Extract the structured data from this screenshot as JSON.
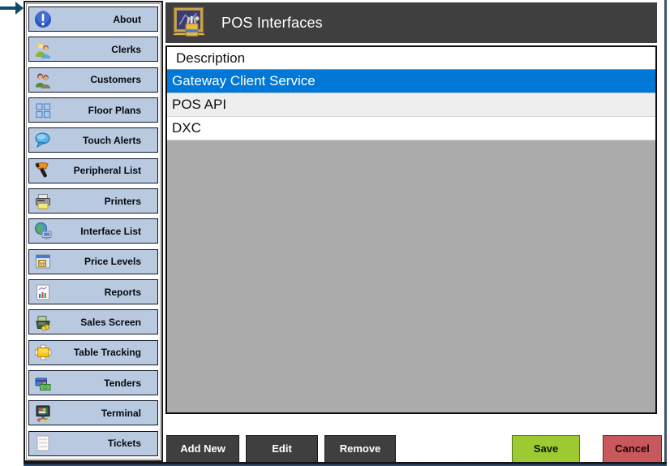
{
  "annotation": {
    "points_to": "Interface List",
    "arrow_color": "#0e4d68"
  },
  "sidebar": {
    "items": [
      {
        "label": "About",
        "icon": "about-icon"
      },
      {
        "label": "Clerks",
        "icon": "clerks-icon"
      },
      {
        "label": "Customers",
        "icon": "customers-icon"
      },
      {
        "label": "Floor Plans",
        "icon": "floor-plans-icon"
      },
      {
        "label": "Touch Alerts",
        "icon": "touch-alerts-icon"
      },
      {
        "label": "Peripheral List",
        "icon": "peripheral-list-icon"
      },
      {
        "label": "Printers",
        "icon": "printers-icon"
      },
      {
        "label": "Interface List",
        "icon": "interface-list-icon"
      },
      {
        "label": "Price Levels",
        "icon": "price-levels-icon"
      },
      {
        "label": "Reports",
        "icon": "reports-icon"
      },
      {
        "label": "Sales Screen",
        "icon": "sales-screen-icon"
      },
      {
        "label": "Table Tracking",
        "icon": "table-tracking-icon"
      },
      {
        "label": "Tenders",
        "icon": "tenders-icon"
      },
      {
        "label": "Terminal",
        "icon": "terminal-icon"
      },
      {
        "label": "Tickets",
        "icon": "tickets-icon"
      }
    ]
  },
  "header": {
    "title": "POS Interfaces",
    "icon": "pos-board-icon"
  },
  "list": {
    "column_header": "Description",
    "rows": [
      {
        "label": "Gateway Client Service",
        "selected": true
      },
      {
        "label": "POS API",
        "selected": false
      },
      {
        "label": "DXC",
        "selected": false
      }
    ]
  },
  "actions": {
    "add_new": "Add New",
    "edit": "Edit",
    "remove": "Remove",
    "save": "Save",
    "cancel": "Cancel"
  },
  "colors": {
    "selection": "#0078d7",
    "header_bg": "#3f3f3f",
    "sidebar_button_bg": "#b9c9df",
    "save_bg": "#9dc932",
    "cancel_bg": "#c9585c",
    "list_empty_bg": "#ababab",
    "arrow": "#0e4d68"
  }
}
